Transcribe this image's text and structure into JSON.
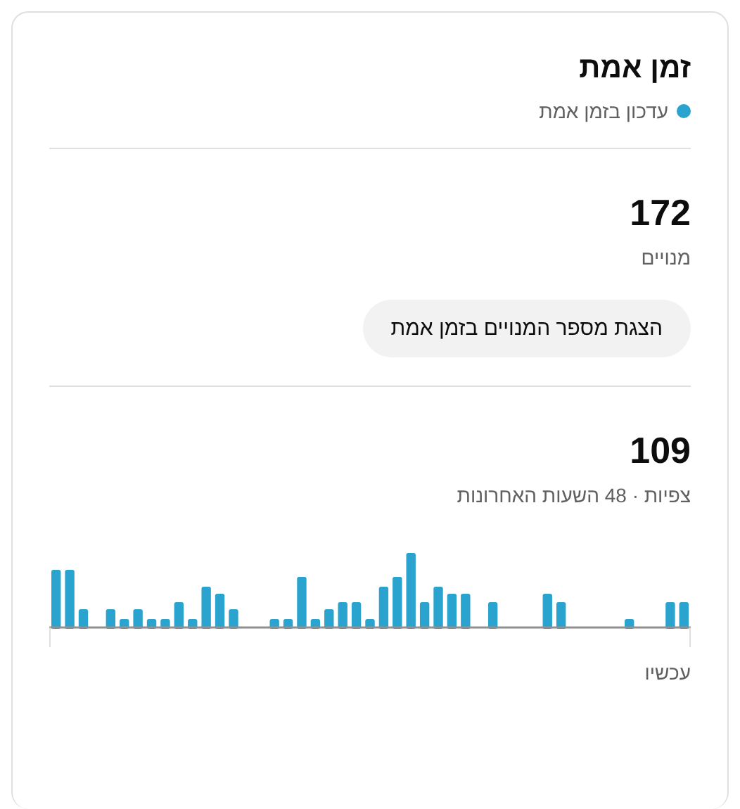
{
  "card": {
    "title": "זמן אמת",
    "status": "עדכון בזמן אמת"
  },
  "subscribers": {
    "value": "172",
    "label": "מנויים",
    "button": "הצגת מספר המנויים בזמן אמת"
  },
  "views": {
    "value": "109",
    "label": "צפיות · 48 השעות האחרונות",
    "axis_label": "עכשיו"
  }
}
